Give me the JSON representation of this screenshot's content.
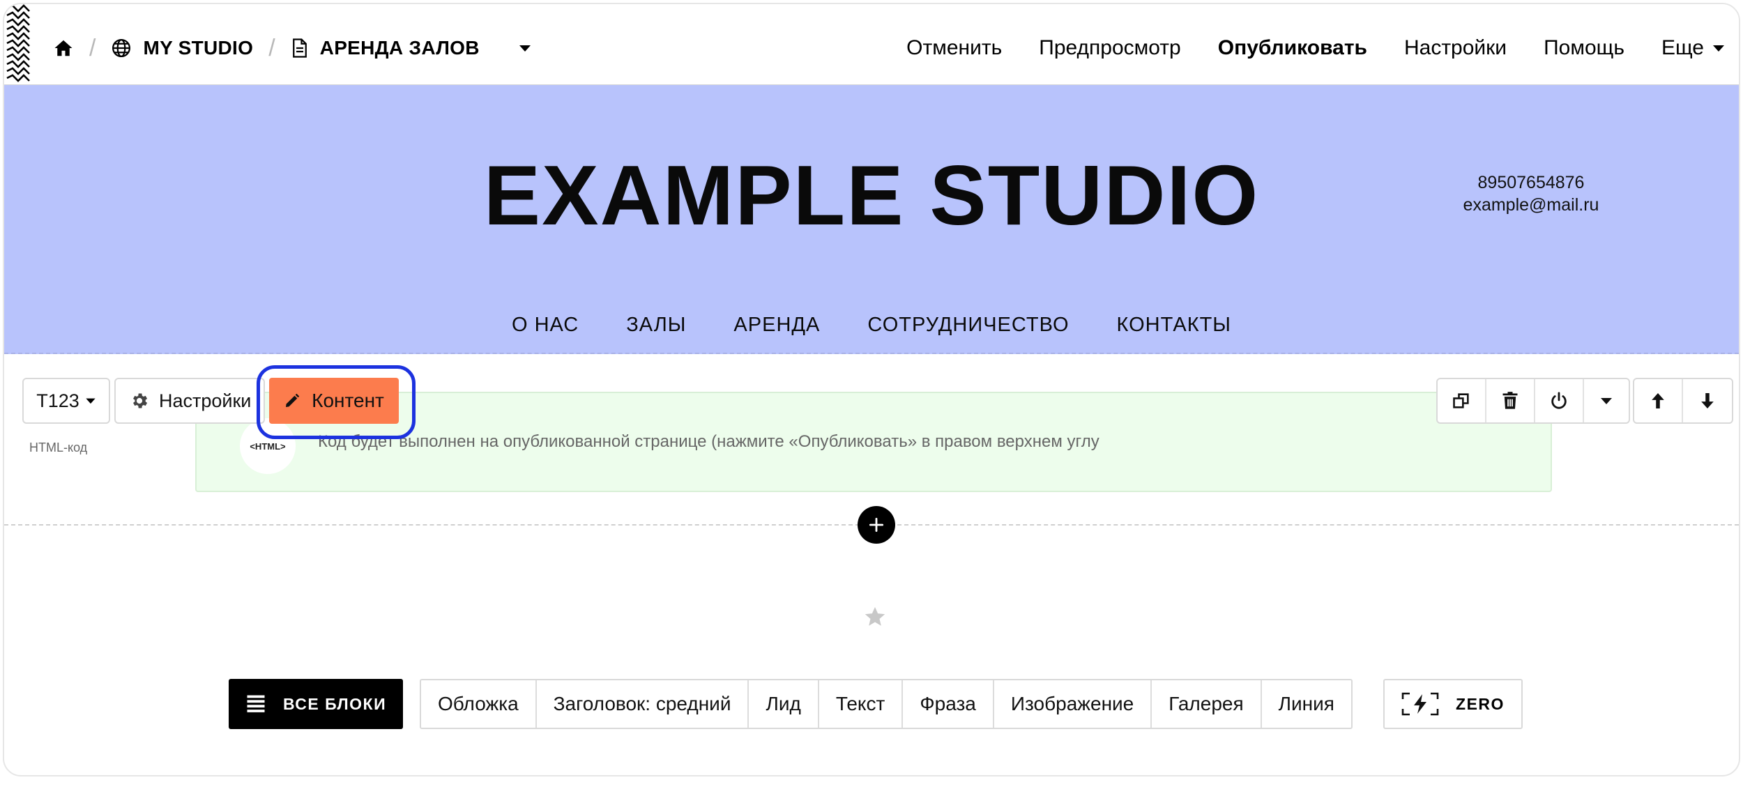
{
  "breadcrumb": {
    "project": "MY STUDIO",
    "page": "АРЕНДА ЗАЛОВ"
  },
  "topmenu": {
    "undo": "Отменить",
    "preview": "Предпросмотр",
    "publish": "Опубликовать",
    "settings": "Настройки",
    "help": "Помощь",
    "more": "Еще"
  },
  "hero": {
    "title": "EXAMPLE STUDIO",
    "phone": "89507654876",
    "email": "example@mail.ru",
    "nav": [
      "О НАС",
      "ЗАЛЫ",
      "АРЕНДА",
      "СОТРУДНИЧЕСТВО",
      "КОНТАКТЫ"
    ]
  },
  "block": {
    "id": "T123",
    "settings_label": "Настройки",
    "content_label": "Контент",
    "type_label": "HTML-код",
    "badge": "<HTML>",
    "description": "Код будет выполнен на опубликованной странице (нажмите «Опубликовать» в правом верхнем углу"
  },
  "library": {
    "all_blocks": "ВСЕ БЛОКИ",
    "chips": [
      "Обложка",
      "Заголовок: средний",
      "Лид",
      "Текст",
      "Фраза",
      "Изображение",
      "Галерея",
      "Линия"
    ],
    "zero": "ZERO"
  },
  "colors": {
    "hero_bg": "#b8c3fc",
    "content_button": "#fc7c4d",
    "highlight": "#1c32df",
    "html_block_bg": "#edfdec"
  }
}
